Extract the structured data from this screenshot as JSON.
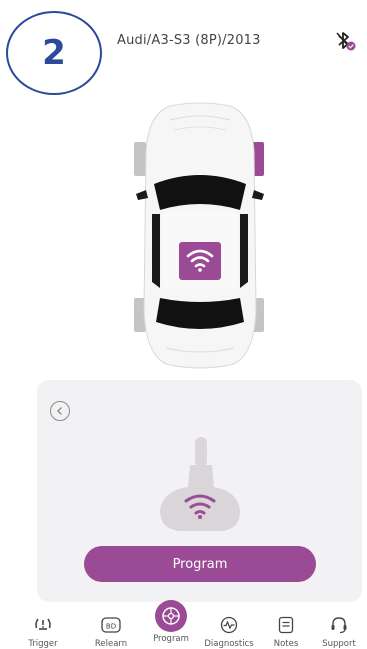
{
  "header": {
    "step": "2",
    "vehicle": "Audi/A3-S3 (8P)/2013",
    "bluetooth_icon": "bluetooth-disconnected-icon"
  },
  "car": {
    "icon": "car-top-view",
    "active_wheel": "front-right",
    "sensor_icon": "wifi-icon"
  },
  "panel": {
    "back_icon": "chevron-left-icon",
    "sensor_icon": "tpms-sensor-icon",
    "program_label": "Program"
  },
  "tabs": [
    {
      "label": "Trigger",
      "icon": "tpms-icon"
    },
    {
      "label": "Relearn",
      "icon": "obd-icon"
    },
    {
      "label": "Program",
      "icon": "wheel-icon",
      "active": true
    },
    {
      "label": "Diagnostics",
      "icon": "pulse-icon"
    },
    {
      "label": "Notes",
      "icon": "notes-icon"
    },
    {
      "label": "Support",
      "icon": "headset-icon"
    }
  ],
  "colors": {
    "accent": "#9b4a96",
    "badge": "#2b4a9a",
    "panel_bg": "#f2f2f4"
  }
}
